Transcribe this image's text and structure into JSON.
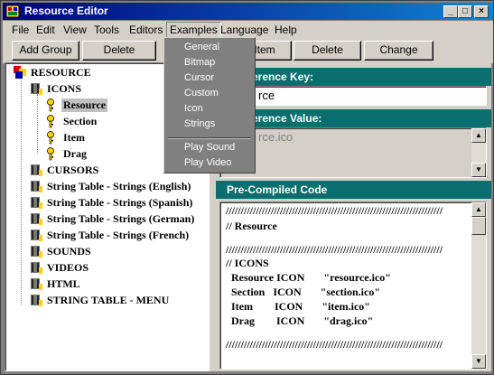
{
  "window": {
    "title": "Resource Editor"
  },
  "menubar": {
    "items": [
      "File",
      "Edit",
      "View",
      "Tools",
      "Editors",
      "Examples",
      "Language",
      "Help"
    ],
    "open_menu": "Examples"
  },
  "examples_menu": {
    "items": [
      "General",
      "Bitmap",
      "Cursor",
      "Custom",
      "Icon",
      "Strings"
    ],
    "items2": [
      "Play Sound",
      "Play Video"
    ]
  },
  "toolbar": {
    "add_group": "Add Group",
    "delete_group": "Delete",
    "add_item": "Item",
    "delete_item": "Delete",
    "change": "Change"
  },
  "tree": {
    "root": "RESOURCE",
    "icons_group": "ICONS",
    "icon_items": [
      "Resource",
      "Section",
      "Item",
      "Drag"
    ],
    "selected": "Resource",
    "groups": [
      "CURSORS",
      "String Table - Strings (English)",
      "String Table - Strings (Spanish)",
      "String Table - Strings (German)",
      "String Table - Strings (French)",
      "SOUNDS",
      "VIDEOS",
      "HTML",
      "STRING TABLE - MENU"
    ]
  },
  "reference_key": {
    "label": "erence Key:",
    "value": "rce"
  },
  "reference_value": {
    "label": "erence Value:",
    "value": "rce.ico"
  },
  "precompiled": {
    "header": "Pre-Compiled Code",
    "lines": [
      "////////////////////////////////////////////////////////////////////////",
      "//  Resource",
      "",
      "////////////////////////////////////////////////////////////////////////",
      "",
      "//  ICONS",
      "  Resource ICON       \"resource.ico\"",
      "  Section   ICON       \"section.ico\"",
      "  Item        ICON       \"item.ico\"",
      "  Drag        ICON       \"drag.ico\"",
      "",
      "////////////////////////////////////////////////////////////////////////"
    ]
  },
  "colors": {
    "titlebar": "#000080",
    "header": "#0a6e6e",
    "face": "#d4d0c8",
    "menu_dropdown": "#808080"
  }
}
